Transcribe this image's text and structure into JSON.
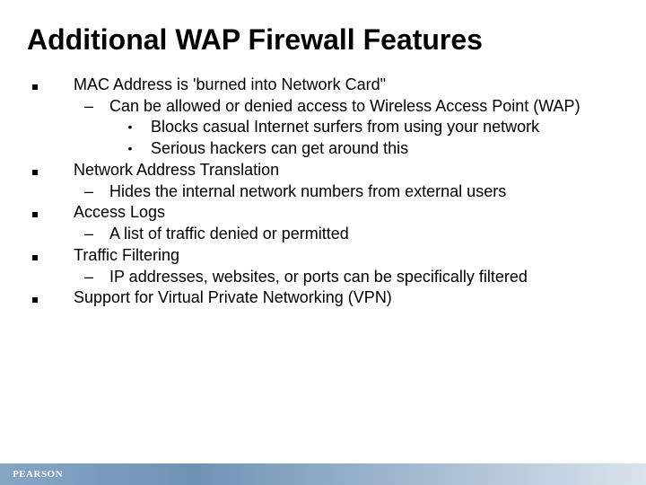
{
  "title": "Additional WAP Firewall Features",
  "lines": {
    "a1": "MAC Address is 'burned into Network Card\"",
    "a1_1": "Can be allowed or denied access to Wireless Access Point (WAP)",
    "a1_1_1": "Blocks casual Internet surfers from using your network",
    "a1_1_2": "Serious hackers can get around this",
    "a2": "Network Address Translation",
    "a2_1": "Hides the internal network numbers from external users",
    "a3": "Access Logs",
    "a3_1": "A list of traffic denied or permitted",
    "a4": "Traffic Filtering",
    "a4_1": "IP addresses, websites, or ports can be specifically filtered",
    "a5": "Support for Virtual Private Networking (VPN)"
  },
  "bullets": {
    "dash": "–",
    "dot": "•"
  },
  "footer": {
    "brand": "PEARSON"
  }
}
